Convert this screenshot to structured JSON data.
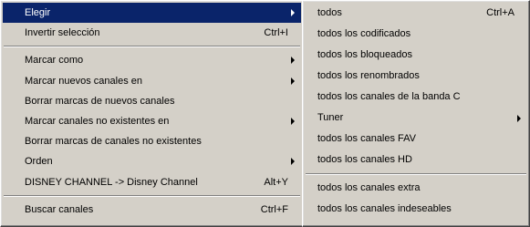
{
  "main_menu": {
    "items": [
      {
        "label": "Elegir",
        "shortcut": "",
        "submenu": true,
        "selected": true
      },
      {
        "label": "Invertir selección",
        "shortcut": "Ctrl+I",
        "submenu": false
      },
      {
        "separator": true
      },
      {
        "label": "Marcar como",
        "shortcut": "",
        "submenu": true
      },
      {
        "label": "Marcar nuevos canales en",
        "shortcut": "",
        "submenu": true
      },
      {
        "label": "Borrar marcas de nuevos canales",
        "shortcut": "",
        "submenu": false
      },
      {
        "label": "Marcar canales no existentes en",
        "shortcut": "",
        "submenu": true
      },
      {
        "label": "Borrar marcas de canales no existentes",
        "shortcut": "",
        "submenu": false
      },
      {
        "label": "Orden",
        "shortcut": "",
        "submenu": true
      },
      {
        "label": "DISNEY CHANNEL -> Disney Channel",
        "shortcut": "Alt+Y",
        "submenu": false
      },
      {
        "separator": true
      },
      {
        "label": "Buscar canales",
        "shortcut": "Ctrl+F",
        "submenu": false
      }
    ]
  },
  "sub_menu": {
    "items": [
      {
        "label": "todos",
        "shortcut": "Ctrl+A",
        "submenu": false
      },
      {
        "label": "todos los codificados",
        "shortcut": "",
        "submenu": false
      },
      {
        "label": "todos los bloqueados",
        "shortcut": "",
        "submenu": false
      },
      {
        "label": "todos los renombrados",
        "shortcut": "",
        "submenu": false
      },
      {
        "label": "todos los canales de la banda C",
        "shortcut": "",
        "submenu": false
      },
      {
        "label": "Tuner",
        "shortcut": "",
        "submenu": true
      },
      {
        "label": "todos los canales FAV",
        "shortcut": "",
        "submenu": false
      },
      {
        "label": "todos los canales HD",
        "shortcut": "",
        "submenu": false
      },
      {
        "separator": true
      },
      {
        "label": "todos los canales extra",
        "shortcut": "",
        "submenu": false
      },
      {
        "label": "todos los canales indeseables",
        "shortcut": "",
        "submenu": false
      }
    ]
  },
  "colors": {
    "menu_bg": "#d4d0c8",
    "highlight_bg": "#0a246a",
    "highlight_text": "#ffffff"
  }
}
